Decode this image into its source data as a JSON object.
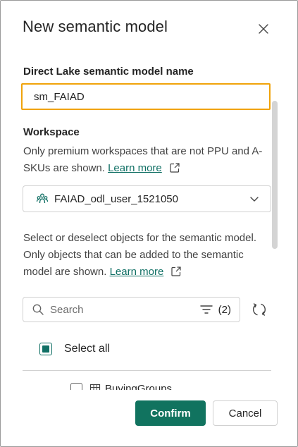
{
  "dialog": {
    "title": "New semantic model",
    "close_icon": "close-icon"
  },
  "name_field": {
    "label": "Direct Lake semantic model name",
    "value": "sm_FAIAD"
  },
  "workspace": {
    "label": "Workspace",
    "description": "Only premium workspaces that are not PPU and A-SKUs are shown.",
    "learn_more": "Learn more",
    "selected": "FAIAD_odl_user_1521050",
    "icon": "workspace-people-icon"
  },
  "objects": {
    "description": "Select or deselect objects for the semantic model. Only objects that can be added to the semantic model are shown.",
    "learn_more": "Learn more"
  },
  "search": {
    "placeholder": "Search",
    "filter_count": "(2)"
  },
  "tree": {
    "select_all_label": "Select all",
    "items": [
      {
        "label": "BuyingGroups",
        "checked": false
      }
    ]
  },
  "footer": {
    "confirm_label": "Confirm",
    "cancel_label": "Cancel"
  },
  "colors": {
    "accent": "#11735f",
    "focus_border": "#f0a30a",
    "link": "#0f6f64"
  }
}
